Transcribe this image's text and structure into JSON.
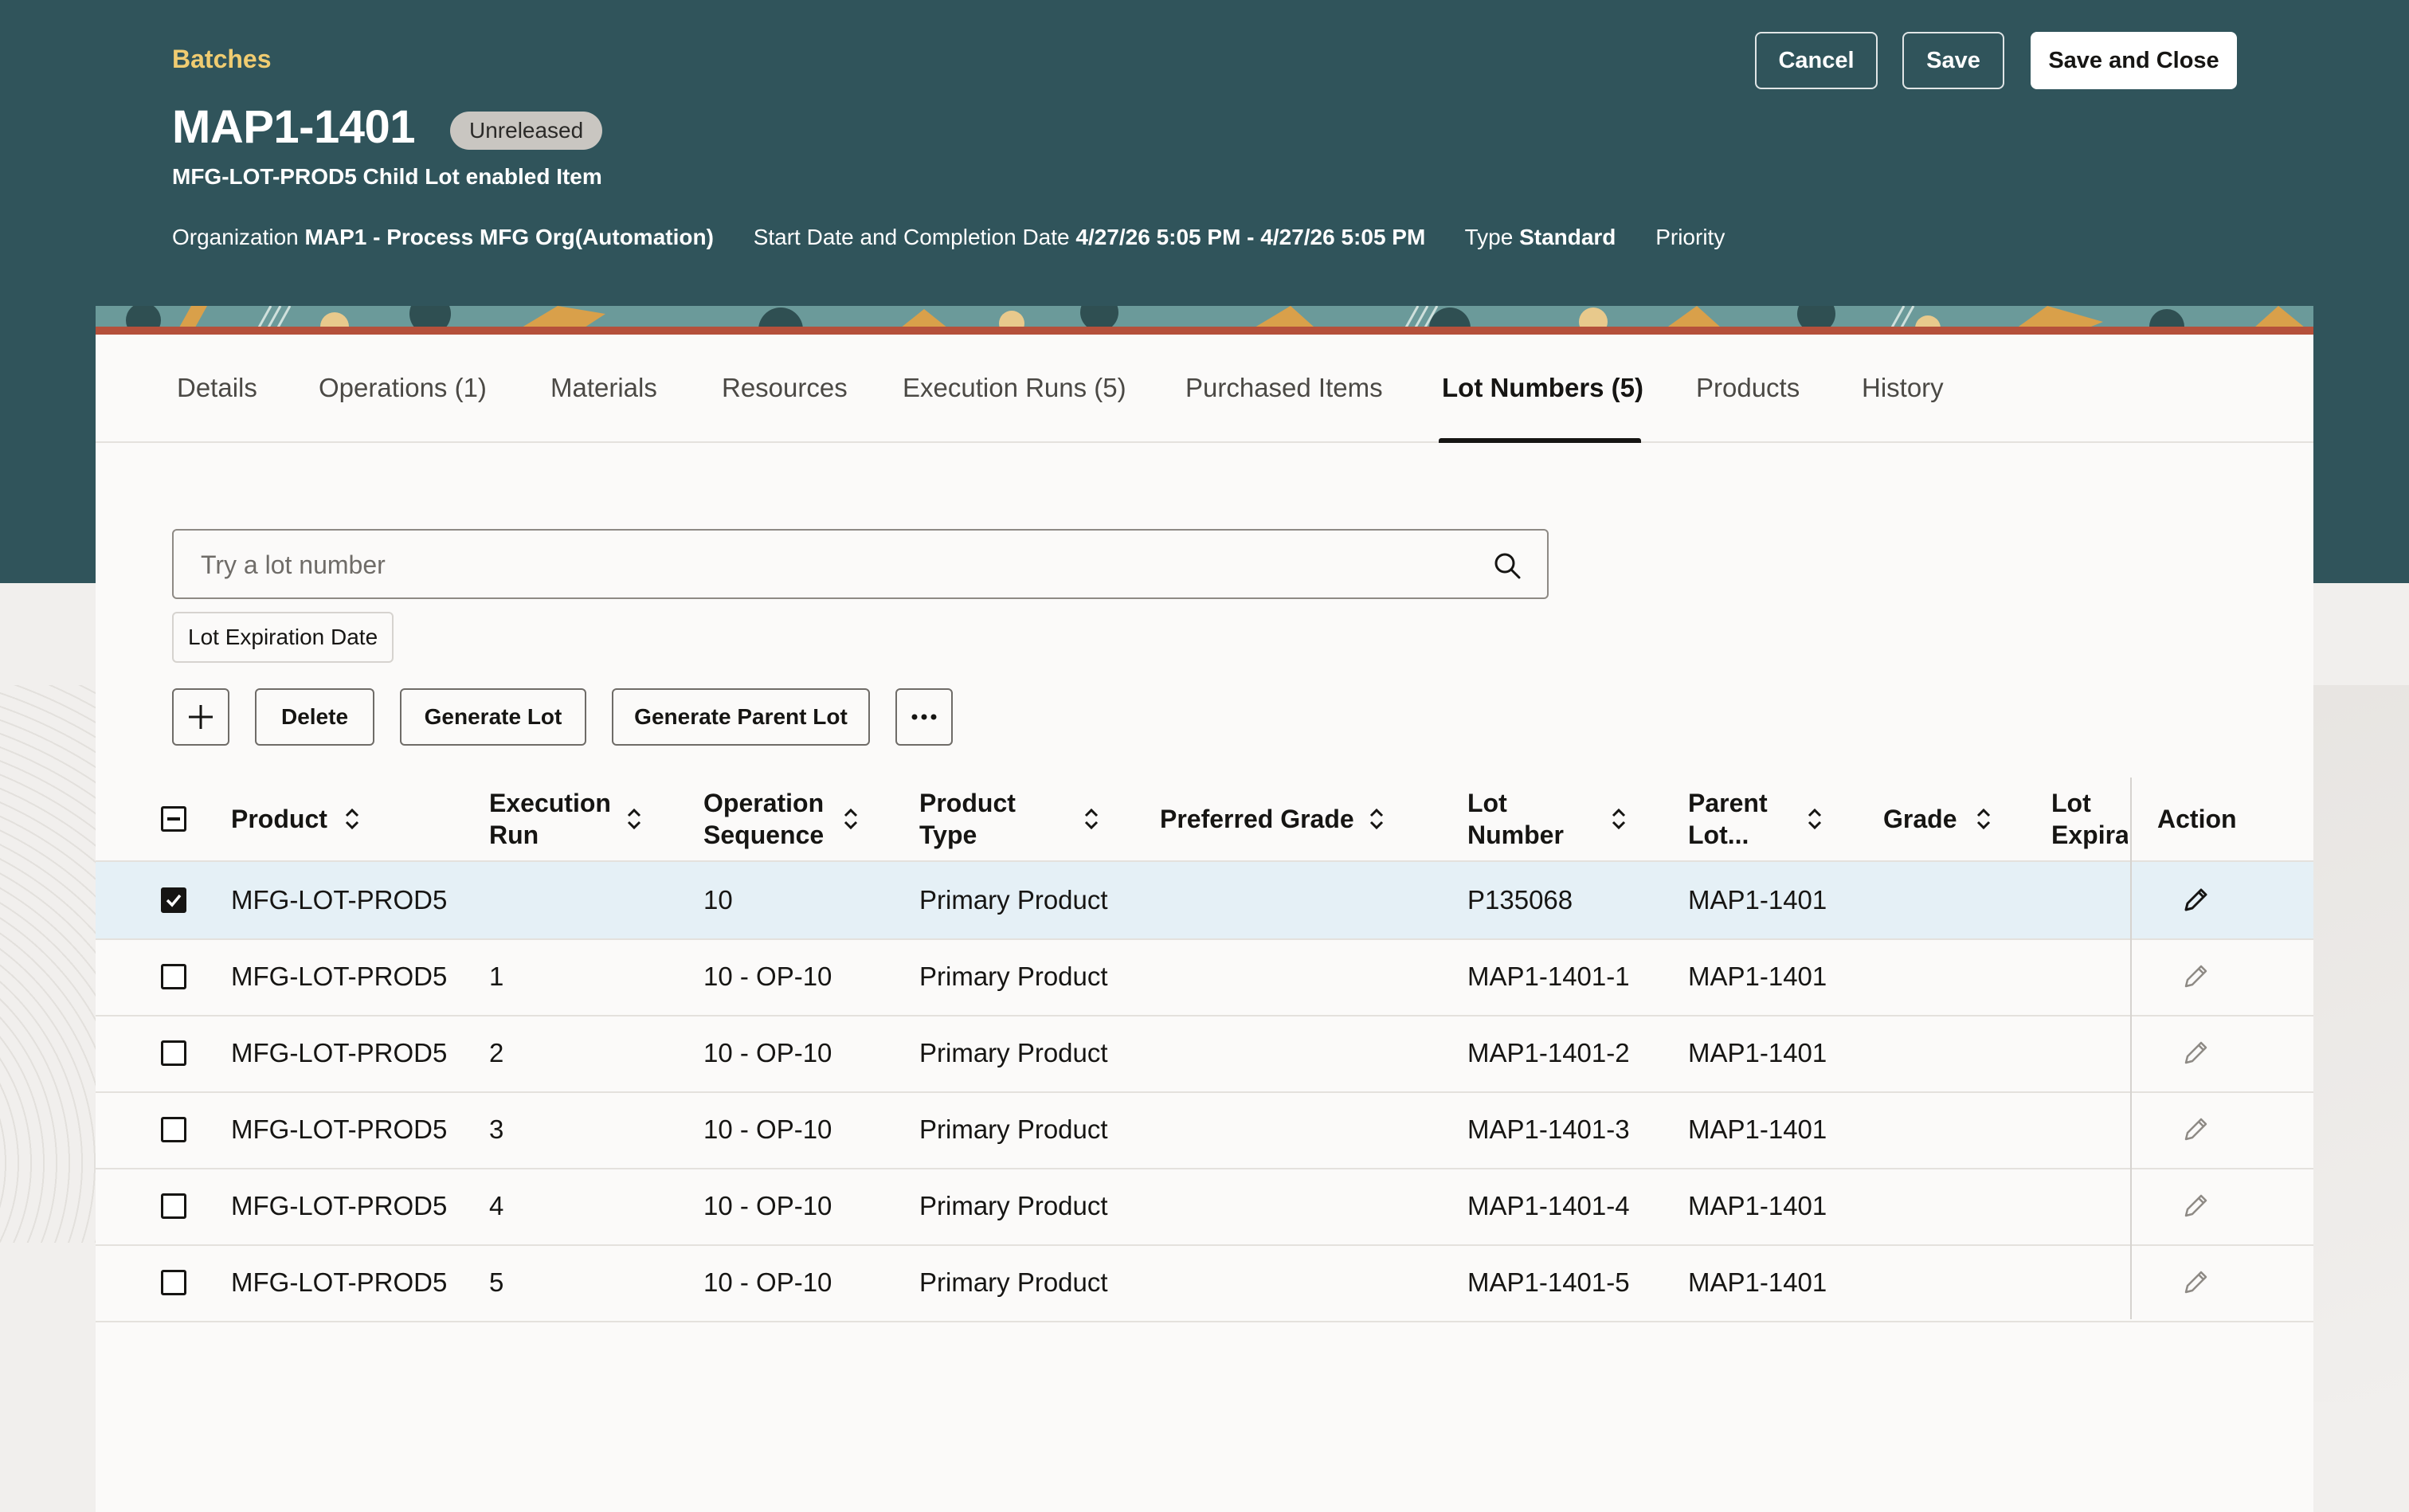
{
  "header": {
    "breadcrumb": "Batches",
    "title": "MAP1-1401",
    "status_badge": "Unreleased",
    "subtitle": "MFG-LOT-PROD5 Child Lot enabled Item",
    "meta": {
      "org_label": "Organization",
      "org_value": "MAP1 - Process MFG Org(Automation)",
      "dates_label": "Start Date and Completion Date",
      "dates_value": "4/27/26 5:05 PM - 4/27/26 5:05 PM",
      "type_label": "Type",
      "type_value": "Standard",
      "priority_label": "Priority"
    },
    "buttons": {
      "cancel": "Cancel",
      "save": "Save",
      "save_close": "Save and Close"
    }
  },
  "tabs": [
    {
      "label": "Details"
    },
    {
      "label": "Operations (1)"
    },
    {
      "label": "Materials"
    },
    {
      "label": "Resources"
    },
    {
      "label": "Execution Runs (5)"
    },
    {
      "label": "Purchased Items"
    },
    {
      "label": "Lot Numbers (5)",
      "active": true
    },
    {
      "label": "Products"
    },
    {
      "label": "History"
    }
  ],
  "search": {
    "placeholder": "Try a lot number",
    "value": ""
  },
  "filter_chip": "Lot Expiration Date",
  "toolbar": {
    "add_icon": "plus-icon",
    "delete": "Delete",
    "generate_lot": "Generate Lot",
    "generate_parent_lot": "Generate Parent Lot",
    "more_icon": "ellipsis-icon"
  },
  "table": {
    "columns": {
      "product": "Product",
      "execution_run_1": "Execution",
      "execution_run_2": "Run",
      "operation_sequence_1": "Operation",
      "operation_sequence_2": "Sequence",
      "product_type_1": "Product",
      "product_type_2": "Type",
      "preferred_grade": "Preferred Grade",
      "lot_number_1": "Lot",
      "lot_number_2": "Number",
      "parent_lot_1": "Parent",
      "parent_lot_2": "Lot...",
      "grade": "Grade",
      "lot_expiration_1": "Lot",
      "lot_expiration_2": "Expirat",
      "action": "Action"
    },
    "rows": [
      {
        "selected": true,
        "product": "MFG-LOT-PROD5",
        "execution_run": "",
        "operation_sequence": "10",
        "product_type": "Primary Product",
        "preferred_grade": "",
        "lot_number": "P135068",
        "parent_lot": "MAP1-1401",
        "grade": "",
        "lot_expiration": ""
      },
      {
        "selected": false,
        "product": "MFG-LOT-PROD5",
        "execution_run": "1",
        "operation_sequence": "10 - OP-10",
        "product_type": "Primary Product",
        "preferred_grade": "",
        "lot_number": "MAP1-1401-1",
        "parent_lot": "MAP1-1401",
        "grade": "",
        "lot_expiration": ""
      },
      {
        "selected": false,
        "product": "MFG-LOT-PROD5",
        "execution_run": "2",
        "operation_sequence": "10 - OP-10",
        "product_type": "Primary Product",
        "preferred_grade": "",
        "lot_number": "MAP1-1401-2",
        "parent_lot": "MAP1-1401",
        "grade": "",
        "lot_expiration": ""
      },
      {
        "selected": false,
        "product": "MFG-LOT-PROD5",
        "execution_run": "3",
        "operation_sequence": "10 - OP-10",
        "product_type": "Primary Product",
        "preferred_grade": "",
        "lot_number": "MAP1-1401-3",
        "parent_lot": "MAP1-1401",
        "grade": "",
        "lot_expiration": ""
      },
      {
        "selected": false,
        "product": "MFG-LOT-PROD5",
        "execution_run": "4",
        "operation_sequence": "10 - OP-10",
        "product_type": "Primary Product",
        "preferred_grade": "",
        "lot_number": "MAP1-1401-4",
        "parent_lot": "MAP1-1401",
        "grade": "",
        "lot_expiration": ""
      },
      {
        "selected": false,
        "product": "MFG-LOT-PROD5",
        "execution_run": "5",
        "operation_sequence": "10 - OP-10",
        "product_type": "Primary Product",
        "preferred_grade": "",
        "lot_number": "MAP1-1401-5",
        "parent_lot": "MAP1-1401",
        "grade": "",
        "lot_expiration": ""
      }
    ]
  },
  "colors": {
    "header_bg": "#30545b",
    "breadcrumb": "#f0cc71",
    "selected_row": "#e5f0f6",
    "page_bg": "#f1efed"
  }
}
